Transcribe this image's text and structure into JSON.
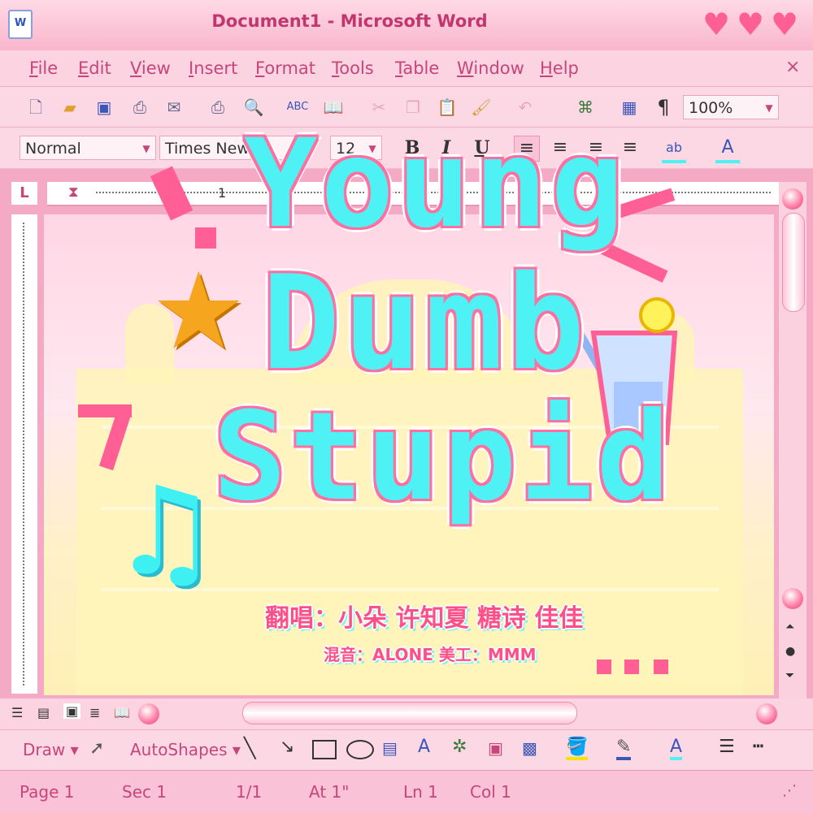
{
  "window": {
    "title": "Document1 - Microsoft Word",
    "app_icon": "W"
  },
  "menu": {
    "items": [
      "File",
      "Edit",
      "View",
      "Insert",
      "Format",
      "Tools",
      "Table",
      "Window",
      "Help"
    ],
    "close": "×"
  },
  "standard_toolbar": {
    "zoom": "100%",
    "pilcrow": "¶"
  },
  "format_toolbar": {
    "style": "Normal",
    "font": "Times New",
    "size": "12",
    "bold": "B",
    "italic": "I",
    "underline": "U"
  },
  "ruler": {
    "tab_marker": "L",
    "mark_1": "1"
  },
  "draw_toolbar": {
    "draw": "Draw",
    "autoshapes": "AutoShapes"
  },
  "status": {
    "page": "Page  1",
    "sec": "Sec  1",
    "pages": "1/1",
    "at": "At  1\"",
    "ln": "Ln  1",
    "col": "Col  1"
  },
  "artwork": {
    "title_lines": [
      "Young",
      "Dumb",
      "Stupid"
    ],
    "credit_line1": "翻唱：小朵 许知夏 糖诗 佳佳",
    "credit_line2": "混音：ALONE 美工：MMM"
  },
  "colors": {
    "accent_pink": "#ff5f95",
    "title_cyan": "#4ff2f4",
    "menu_text": "#c8457a"
  }
}
